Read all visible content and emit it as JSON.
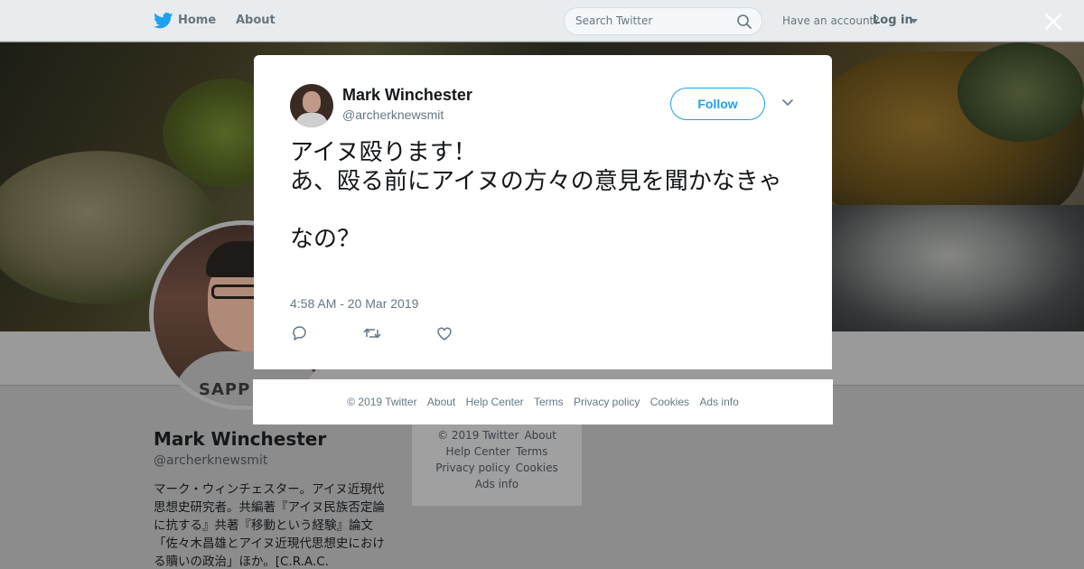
{
  "nav": {
    "home": "Home",
    "about": "About",
    "search_placeholder": "Search Twitter",
    "account_question": "Have an account?",
    "login": "Log in"
  },
  "tweet": {
    "name": "Mark Winchester",
    "handle": "@archerknewsmit",
    "follow": "Follow",
    "text": "アイヌ殴ります！\nあ、殴る前にアイヌの方々の意見を聞かなきゃ\n\nなの？",
    "time": "4:58 AM - 20 Mar 2019"
  },
  "modal_footer": {
    "items": [
      "© 2019 Twitter",
      "About",
      "Help Center",
      "Terms",
      "Privacy policy",
      "Cookies",
      "Ads info"
    ]
  },
  "profile": {
    "name": "Mark Winchester",
    "handle": "@archerknewsmit",
    "bio": "マーク・ウィンチェスター。アイヌ近現代思想史研究者。共編著『アイヌ民族否定論に抗する』共著『移動という経験』論文「佐々木昌雄とアイヌ近現代思想史における贖いの政治」ほか。[C.R.A.C.",
    "shirt_text": "SAPP"
  },
  "side_footer": {
    "row1": [
      "© 2019 Twitter",
      "About"
    ],
    "row2": [
      "Help Center",
      "Terms"
    ],
    "row3": [
      "Privacy policy",
      "Cookies"
    ],
    "row4": [
      "Ads info"
    ]
  },
  "colors": {
    "accent": "#1da1f2",
    "text_primary": "#14171a",
    "text_secondary": "#657786"
  }
}
